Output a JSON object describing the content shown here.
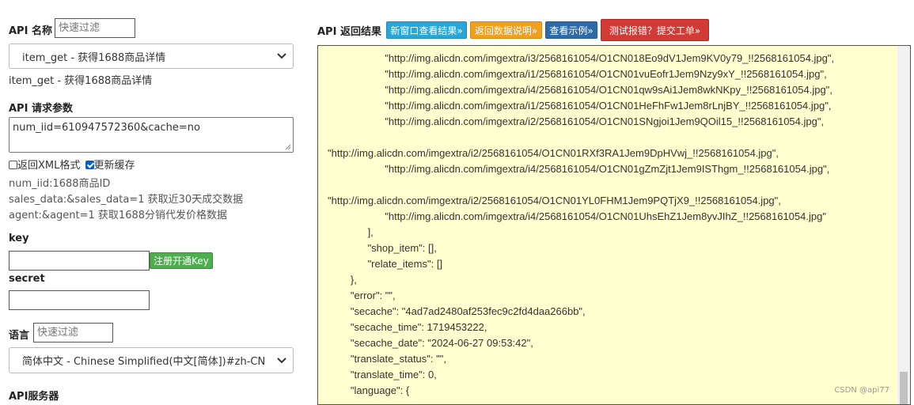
{
  "left_panel": {
    "api_name_label": "API 名称",
    "api_filter_placeholder": "快速过滤",
    "api_select_value": "item_get - 获得1688商品详情",
    "api_description": "item_get - 获得1688商品详情",
    "params_label": "API 请求参数",
    "params_value": "num_iid=610947572360&cache=no",
    "xml_checkbox_label": "返回XML格式",
    "cache_checkbox_label": "更新缓存",
    "xml_checked": false,
    "cache_checked": true,
    "param_help": [
      "num_iid:1688商品ID",
      "sales_data:&sales_data=1 获取近30天成交数据",
      "agent:&agent=1 获取1688分销代发价格数据"
    ],
    "key_label": "key",
    "register_key_button": "注册开通Key",
    "secret_label": "secret",
    "lang_label": "语言",
    "lang_filter_placeholder": "快速过滤",
    "lang_select_value": "简体中文 - Chinese Simplified(中文[简体])#zh-CN",
    "server_label": "API服务器"
  },
  "right_panel": {
    "result_label": "API 返回结果",
    "buttons": {
      "new_window": "新窗口查看结果»",
      "return_doc": "返回数据说明»",
      "example": "查看示例»",
      "report_bug": "测试报错？提交工单»"
    },
    "code_lines": [
      "                    \"http://img.alicdn.com/imgextra/i3/2568161054/O1CN018Eo9dV1Jem9KV0y79_!!2568161054.jpg\",",
      "                    \"http://img.alicdn.com/imgextra/i1/2568161054/O1CN01vuEofr1Jem9Nzy9xY_!!2568161054.jpg\",",
      "                    \"http://img.alicdn.com/imgextra/i4/2568161054/O1CN01qw9sAi1Jem8wkNKpy_!!2568161054.jpg\",",
      "                    \"http://img.alicdn.com/imgextra/i1/2568161054/O1CN01HeFhFw1Jem8rLnjBY_!!2568161054.jpg\",",
      "                    \"http://img.alicdn.com/imgextra/i2/2568161054/O1CN01SNgjoi1Jem9QOil15_!!2568161054.jpg\",",
      "",
      "\"http://img.alicdn.com/imgextra/i2/2568161054/O1CN01RXf3RA1Jem9DpHVwj_!!2568161054.jpg\",",
      "                    \"http://img.alicdn.com/imgextra/i4/2568161054/O1CN01gZmZjt1Jem9ISThgm_!!2568161054.jpg\",",
      "",
      "\"http://img.alicdn.com/imgextra/i2/2568161054/O1CN01YL0FHM1Jem9PQTjX9_!!2568161054.jpg\",",
      "                    \"http://img.alicdn.com/imgextra/i4/2568161054/O1CN01UhsEhZ1Jem8yvJIhZ_!!2568161054.jpg\"",
      "              ],",
      "              \"shop_item\": [],",
      "              \"relate_items\": []",
      "        },",
      "        \"error\": \"\",",
      "        \"secache\": \"4ad7ad2480af253fec9c2fd4daa266bb\",",
      "        \"secache_time\": 1719453222,",
      "        \"secache_date\": \"2024-06-27 09:53:42\",",
      "        \"translate_status\": \"\",",
      "        \"translate_time\": 0,",
      "        \"language\": {"
    ],
    "watermark": "CSDN @api77"
  },
  "colors": {
    "btn_blue_light": "#2aa6d6",
    "btn_orange": "#f0a020",
    "btn_blue_dark": "#2d6aa8",
    "btn_red": "#d23b35",
    "btn_green": "#4cae4c",
    "result_bg": "#ffffd0"
  }
}
